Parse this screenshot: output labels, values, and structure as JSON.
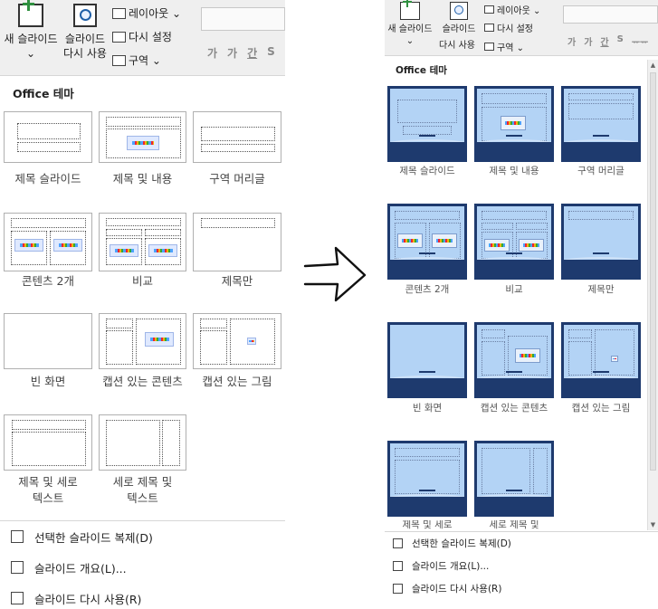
{
  "ribbon": {
    "new_slide_label": "새 슬라이드",
    "new_slide_chevron": "⌄",
    "reuse_line1": "슬라이드",
    "reuse_line2": "다시 사용",
    "layout_label": "레이아웃 ⌄",
    "reset_label": "다시 설정",
    "section_label": "구역 ⌄",
    "format_buttons": [
      "가",
      "가",
      "간",
      "S"
    ],
    "format_buttons_right": [
      "가",
      "가",
      "간",
      "S",
      "ᅲᅲ"
    ]
  },
  "theme_header": "Office 테마",
  "layouts": [
    {
      "label": "제목 슬라이드"
    },
    {
      "label": "제목 및 내용"
    },
    {
      "label": "구역 머리글"
    },
    {
      "label": "콘텐츠 2개"
    },
    {
      "label": "비교"
    },
    {
      "label": "제목만"
    },
    {
      "label": "빈 화면"
    },
    {
      "label": "캡션 있는 콘텐츠"
    },
    {
      "label": "캡션 있는 그림"
    },
    {
      "label": "제목 및 세로\n텍스트"
    },
    {
      "label": "세로 제목 및\n텍스트"
    }
  ],
  "layouts_right_truncated": [
    "제목 및 세로",
    "세로 제목 및"
  ],
  "menu": [
    {
      "text": "선택한 슬라이드 복제(D)",
      "icon": "duplicate-slide-icon"
    },
    {
      "text": "슬라이드 개요(L)...",
      "icon": "outline-icon"
    },
    {
      "text": "슬라이드 다시 사용(R)",
      "icon": "reuse-slides-icon"
    }
  ],
  "colors": {
    "theme_blue": "#b3d3f5",
    "theme_navy": "#1e3a6e",
    "plus_green": "#2f8f3f"
  }
}
